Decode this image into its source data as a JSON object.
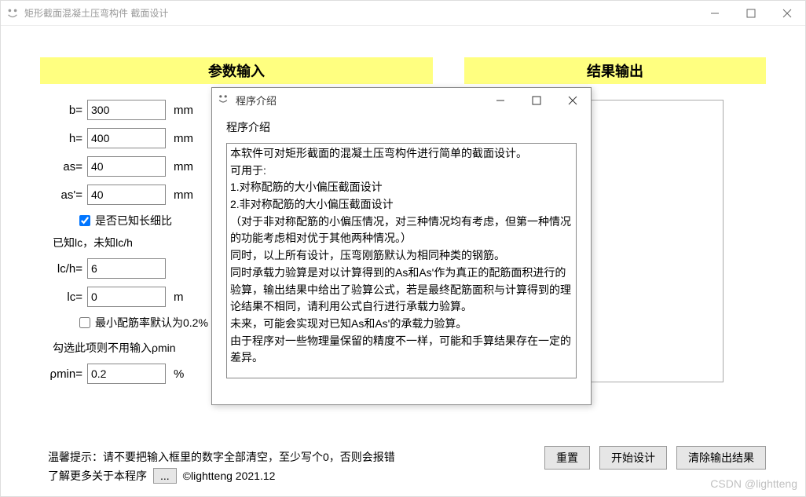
{
  "window": {
    "title": "矩形截面混凝土压弯构件 截面设计"
  },
  "sections": {
    "input_header": "参数输入",
    "output_header": "结果输出"
  },
  "fields": {
    "b": {
      "label": "b=",
      "value": "300",
      "unit": "mm"
    },
    "h": {
      "label": "h=",
      "value": "400",
      "unit": "mm"
    },
    "as": {
      "label": "as=",
      "value": "40",
      "unit": "mm"
    },
    "asp": {
      "label": "as'=",
      "value": "40",
      "unit": "mm"
    },
    "lch": {
      "label": "lc/h=",
      "value": "6",
      "unit": ""
    },
    "lc": {
      "label": "lc=",
      "value": "0",
      "unit": "m"
    },
    "rhomin": {
      "label": "ρmin=",
      "value": "0.2",
      "unit": "%"
    }
  },
  "checks": {
    "knowSlender": "是否已知长细比",
    "knowLcText": "已知lc，未知lc/h",
    "minRatioDefault": "最小配筋率默认为0.2%"
  },
  "hints": {
    "noRhomin": "勾选此项则不用输入ρmin"
  },
  "footer": {
    "warning": "温馨提示：请不要把输入框里的数字全部清空，至少写个0，否则会报错",
    "moreInfo": "了解更多关于本程序",
    "dots": "...",
    "copyright": "©lightteng 2021.12"
  },
  "buttons": {
    "reset": "重置",
    "start": "开始设计",
    "clear": "清除输出结果"
  },
  "dialog": {
    "title": "程序介绍",
    "heading": "程序介绍",
    "body": "本软件可对矩形截面的混凝土压弯构件进行简单的截面设计。\n可用于:\n1.对称配筋的大小偏压截面设计\n2.非对称配筋的大小偏压截面设计\n（对于非对称配筋的小偏压情况，对三种情况均有考虑，但第一种情况的功能考虑相对优于其他两种情况。）\n同时，以上所有设计，压弯刚筋默认为相同种类的钢筋。\n同时承载力验算是对以计算得到的As和As'作为真正的配筋面积进行的验算，输出结果中给出了验算公式，若是最终配筋面积与计算得到的理论结果不相同，请利用公式自行进行承载力验算。\n未来，可能会实现对已知As和As'的承载力验算。\n由于程序对一些物理量保留的精度不一样，可能和手算结果存在一定的差异。"
  },
  "watermark": "CSDN @lightteng"
}
